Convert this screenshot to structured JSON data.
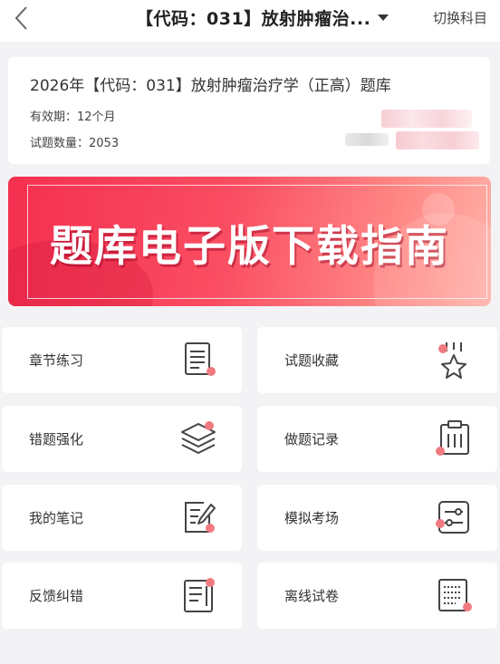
{
  "header": {
    "title": "【代码：031】放射肿瘤治...",
    "switch_label": "切换科目"
  },
  "info": {
    "title": "2026年【代码：031】放射肿瘤治疗学（正高）题库",
    "validity_label": "有效期：",
    "validity_value": "12个月",
    "count_label": "试题数量：",
    "count_value": "2053"
  },
  "banner": {
    "text": "题库电子版下载指南"
  },
  "colors": {
    "accent": "#f4304f",
    "dot": "#f07a80",
    "icon_stroke": "#444444"
  },
  "grid": [
    {
      "label": "章节练习",
      "icon": "document-icon"
    },
    {
      "label": "试题收藏",
      "icon": "star-medal-icon"
    },
    {
      "label": "错题强化",
      "icon": "layers-icon"
    },
    {
      "label": "做题记录",
      "icon": "clipboard-icon"
    },
    {
      "label": "我的笔记",
      "icon": "note-pencil-icon"
    },
    {
      "label": "模拟考场",
      "icon": "sliders-icon"
    },
    {
      "label": "反馈纠错",
      "icon": "feedback-list-icon"
    },
    {
      "label": "离线试卷",
      "icon": "offline-paper-icon"
    }
  ]
}
